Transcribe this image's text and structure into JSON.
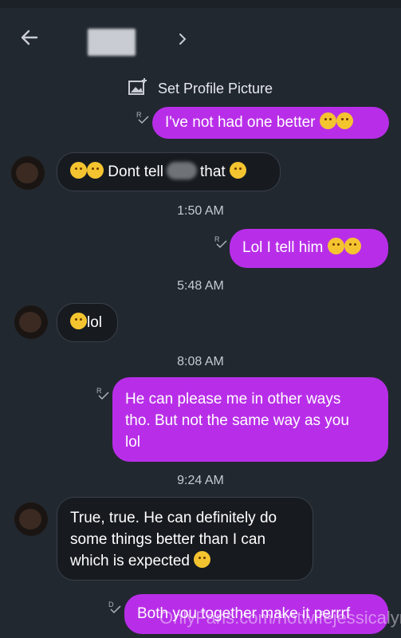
{
  "header": {
    "contact_name": ""
  },
  "system_event": {
    "text": "Set Profile Picture"
  },
  "messages": [
    {
      "dir": "out",
      "text": "I've not had one better",
      "emoji": [
        "relieved-face",
        "relieved-face"
      ],
      "receipt": "R"
    },
    {
      "dir": "in",
      "before": "Dont tell",
      "after": "that",
      "emoji_before": [
        "grinning-face",
        "kissing-face"
      ],
      "emoji_after": [
        "laughing-face"
      ]
    },
    {
      "dir": "out",
      "text": "Lol I tell him",
      "emoji": [
        "rolling-laughing-face",
        "relieved-face"
      ],
      "receipt": "R"
    },
    {
      "dir": "in",
      "text": "lol",
      "emoji_before": [
        "flushed-face"
      ]
    },
    {
      "dir": "out",
      "lines": [
        "He can please me in other ways",
        "tho. But not the same way as you",
        "lol"
      ],
      "receipt": "R"
    },
    {
      "dir": "in",
      "lines": [
        "True, true. He can definitely do",
        "some things better than I can",
        "which is expected"
      ],
      "emoji_after": [
        "upside-down-face"
      ]
    },
    {
      "dir": "out",
      "text": "Both you together make it perrrf",
      "receipt": "D"
    }
  ],
  "timestamps": [
    "1:50 AM",
    "5:48 AM",
    "8:08 AM",
    "9:24 AM"
  ],
  "receipt_letters": {
    "r": "R",
    "d": "D"
  },
  "watermark": "OnlyFans.com/hotwifejessicalynn",
  "colors": {
    "background": "#222830",
    "outgoing": "#b82ee8",
    "incoming": "#171b20"
  }
}
